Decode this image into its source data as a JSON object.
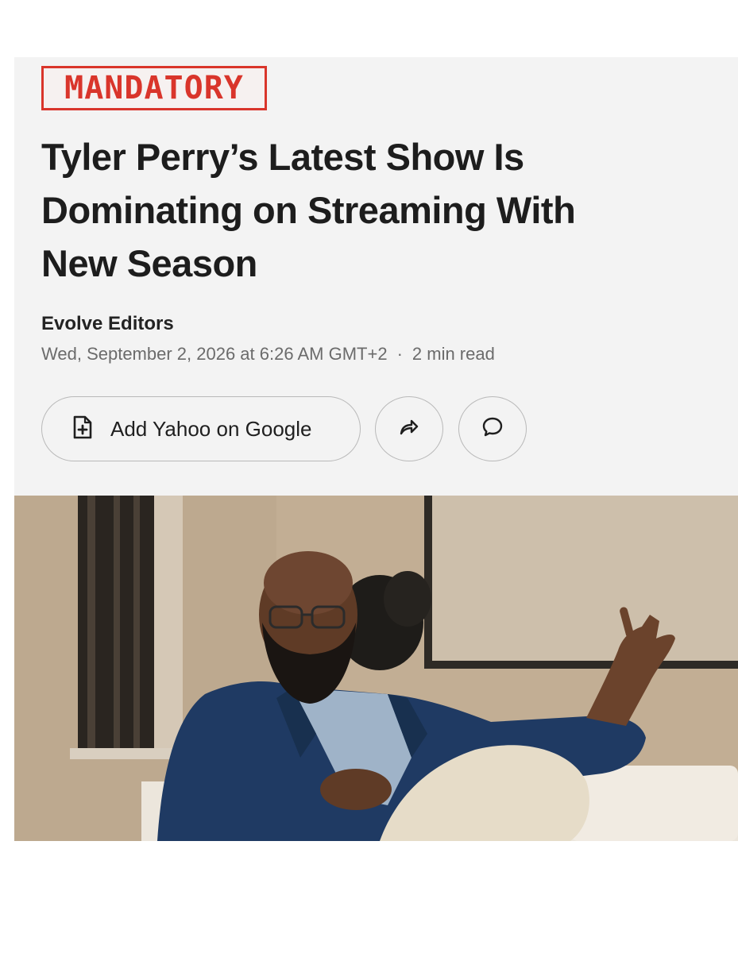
{
  "brand": {
    "logo_text": "MANDATORY"
  },
  "article": {
    "headline_lines": [
      "Tyler Perry’s Latest Show Is",
      "Dominating on Streaming With",
      "New Season"
    ],
    "author": "Evolve Editors",
    "date": "Wed, September 2, 2026 at 6:26 AM GMT+2",
    "separator": "·",
    "read_time": "2 min read"
  },
  "actions": {
    "add_label": "Add Yahoo on Google",
    "add_icon": "add-document-icon",
    "share_icon": "share-arrow-icon",
    "comment_icon": "speech-bubble-icon"
  },
  "hero_image": {
    "subject": "bald bearded man with glasses in navy blazer and light blue shirt seated on white sofa, gesturing"
  },
  "colors": {
    "brand_red": "#d9352b",
    "card_bg": "#f3f3f3",
    "headline": "#1d1d1d",
    "meta_gray": "#6b6b6b"
  }
}
